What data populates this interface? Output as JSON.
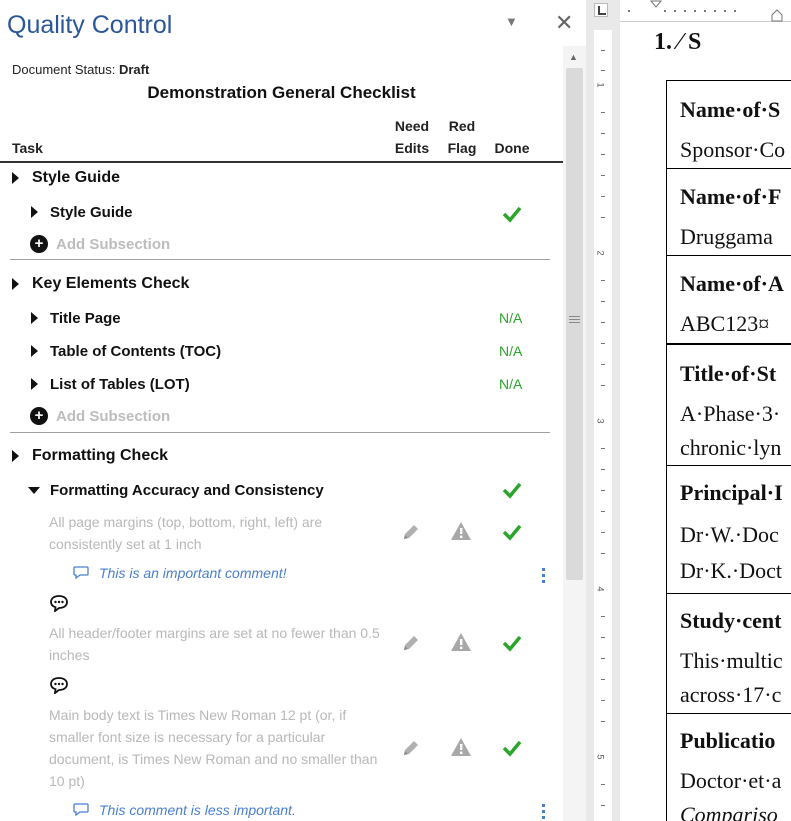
{
  "pane": {
    "title": "Quality Control",
    "menu_glyph": "▼",
    "close_glyph": "✕",
    "status_label": "Document Status:",
    "status_value": "Draft",
    "checklist_title": "Demonstration General Checklist",
    "columns": {
      "task": "Task",
      "need_edits_1": "Need",
      "need_edits_2": "Edits",
      "red_flag_1": "Red",
      "red_flag_2": "Flag",
      "done": "Done"
    },
    "add_subsection": "Add Subsection",
    "sections": [
      {
        "label": "Style Guide",
        "subsections": [
          {
            "label": "Style Guide",
            "status": "check"
          }
        ]
      },
      {
        "label": "Key Elements Check",
        "subsections": [
          {
            "label": "Title Page",
            "status": "N/A"
          },
          {
            "label": "Table of Contents (TOC)",
            "status": "N/A"
          },
          {
            "label": "List of Tables (LOT)",
            "status": "N/A"
          }
        ]
      },
      {
        "label": "Formatting Check",
        "subsections": [
          {
            "label": "Formatting Accuracy and Consistency",
            "status": "check",
            "expanded": true,
            "items": [
              {
                "text": "All page margins (top, bottom, right, left) are consistently set at 1 inch",
                "comment": "This is an important comment!"
              },
              {
                "text": "All header/footer margins are set at no fewer than 0.5 inches"
              },
              {
                "text": "Main body text is Times New Roman 12 pt (or, if smaller font size is necessary for a particular document, is Times New Roman and no smaller than 10 pt)",
                "comment": "This comment is less important."
              }
            ]
          }
        ]
      }
    ],
    "icons": {
      "expand": "triangle-right-icon",
      "collapse": "triangle-down-icon",
      "add": "plus-circle-icon",
      "done": "checkmark-icon",
      "edit": "pencil-icon",
      "flag": "warning-triangle-icon",
      "comment": "speech-bubble-icon",
      "more": "vertical-ellipsis-icon"
    },
    "colors": {
      "title": "#2b579a",
      "check": "#2ca52c",
      "comment": "#4a7fd0",
      "disabled_text": "#b8b8b8"
    }
  },
  "document": {
    "heading": "1.    ⁄    S",
    "ruler_numbers": [
      "1",
      "2",
      "3",
      "4",
      "5"
    ],
    "rows": [
      {
        "label": "Name·of·S",
        "lines": [
          "Sponsor·Co"
        ]
      },
      {
        "label": "Name·of·F",
        "lines": [
          "Druggama"
        ]
      },
      {
        "label": "Name·of·A",
        "lines": [
          "ABC123¤"
        ]
      },
      {
        "label": "Title·of·St",
        "lines": [
          "A·Phase·3·",
          "chronic·lyn"
        ]
      },
      {
        "label": "Principal·I",
        "lines": [
          "Dr·W.·Doc",
          "Dr·K.·Doct"
        ]
      },
      {
        "label": "Study·cent",
        "lines": [
          "This·multic",
          "across·17·c"
        ]
      },
      {
        "label": "Publicatio",
        "lines": [
          "Doctor·et·a",
          "Compariso"
        ]
      }
    ]
  }
}
